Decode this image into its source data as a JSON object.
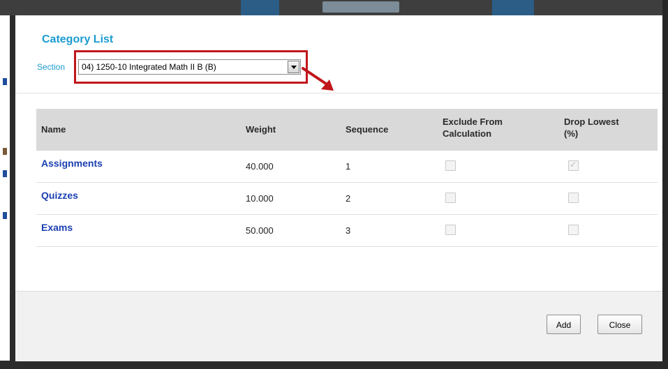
{
  "dialog": {
    "title": "Category List",
    "section_label": "Section",
    "section_selected": "04) 1250-10 Integrated Math II B (B)"
  },
  "table": {
    "headers": {
      "name": "Name",
      "weight": "Weight",
      "sequence": "Sequence",
      "exclude_line1": "Exclude From",
      "exclude_line2": "Calculation",
      "drop_line1": "Drop Lowest",
      "drop_line2": "(%)"
    },
    "rows": [
      {
        "name": "Assignments",
        "weight": "40.000",
        "sequence": "1",
        "exclude": false,
        "drop_lowest": true
      },
      {
        "name": "Quizzes",
        "weight": "10.000",
        "sequence": "2",
        "exclude": false,
        "drop_lowest": false
      },
      {
        "name": "Exams",
        "weight": "50.000",
        "sequence": "3",
        "exclude": false,
        "drop_lowest": false
      }
    ]
  },
  "footer": {
    "add_label": "Add",
    "close_label": "Close"
  },
  "colors": {
    "title": "#1b9bd1",
    "link": "#1a3fb2",
    "highlight": "#c0161c",
    "header_bg": "#d9d9d9"
  }
}
